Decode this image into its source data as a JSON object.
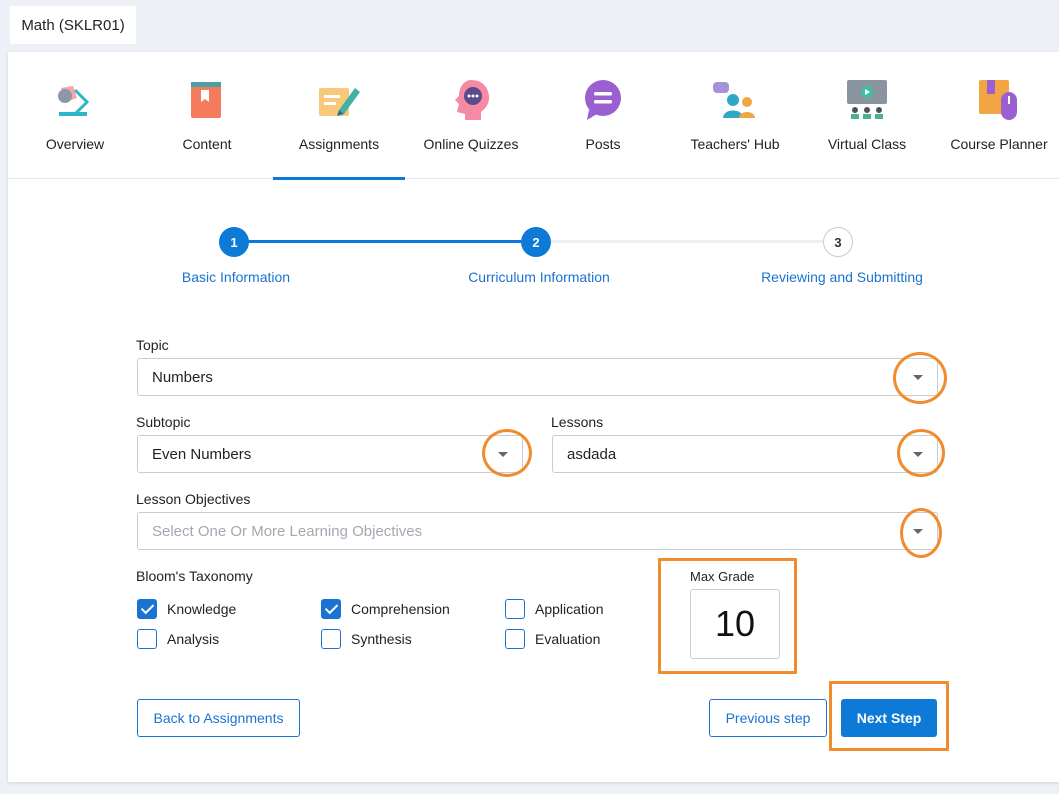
{
  "course_tab": "Math (SKLR01)",
  "nav": [
    {
      "label": "Overview",
      "icon": "overview-icon"
    },
    {
      "label": "Content",
      "icon": "book-icon"
    },
    {
      "label": "Assignments",
      "icon": "assignment-icon",
      "active": true
    },
    {
      "label": "Online Quizzes",
      "icon": "quiz-icon"
    },
    {
      "label": "Posts",
      "icon": "posts-icon"
    },
    {
      "label": "Teachers' Hub",
      "icon": "teachers-hub-icon"
    },
    {
      "label": "Virtual Class",
      "icon": "virtual-class-icon"
    },
    {
      "label": "Course Planner",
      "icon": "course-planner-icon"
    }
  ],
  "stepper": [
    {
      "number": "1",
      "label": "Basic Information",
      "status": "done"
    },
    {
      "number": "2",
      "label": "Curriculum Information",
      "status": "current"
    },
    {
      "number": "3",
      "label": "Reviewing and Submitting",
      "status": "todo"
    }
  ],
  "form": {
    "topic": {
      "label": "Topic",
      "value": "Numbers"
    },
    "subtopic": {
      "label": "Subtopic",
      "value": "Even Numbers"
    },
    "lessons": {
      "label": "Lessons",
      "value": "asdada"
    },
    "objectives": {
      "label": "Lesson Objectives",
      "placeholder": "Select One Or More Learning Objectives"
    },
    "blooms": {
      "label": "Bloom's Taxonomy",
      "options": [
        {
          "label": "Knowledge",
          "checked": true
        },
        {
          "label": "Comprehension",
          "checked": true
        },
        {
          "label": "Application",
          "checked": false
        },
        {
          "label": "Analysis",
          "checked": false
        },
        {
          "label": "Synthesis",
          "checked": false
        },
        {
          "label": "Evaluation",
          "checked": false
        }
      ]
    },
    "max_grade": {
      "label": "Max Grade",
      "value": "10"
    }
  },
  "buttons": {
    "back": "Back to Assignments",
    "previous": "Previous step",
    "next": "Next Step"
  },
  "colors": {
    "accent": "#0c7ad6",
    "highlight": "#f08c2e"
  }
}
